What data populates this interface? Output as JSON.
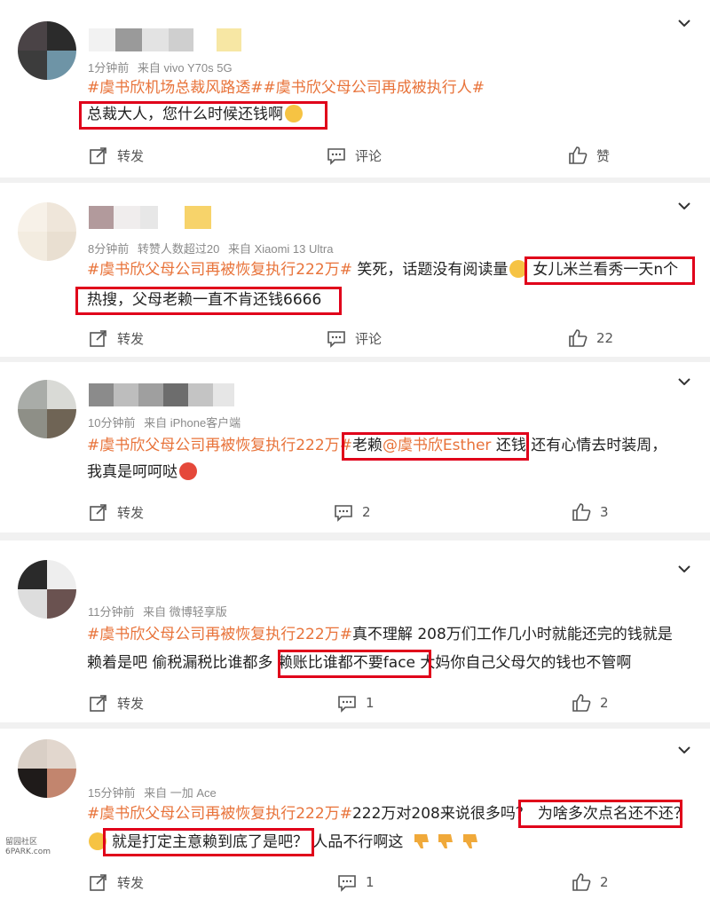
{
  "posts": [
    {
      "meta_time": "1分钟前",
      "meta_extra": "",
      "meta_source": "来自 vivo Y70s 5G",
      "line1_tag": "#虞书欣机场总裁风路透##虞书欣父母公司再成被执行人#",
      "line1_text": "",
      "line2_text": "总裁大人，您什么时候还钱啊",
      "repost_label": "转发",
      "comment_label": "评论",
      "like_label": "赞"
    },
    {
      "meta_time": "8分钟前",
      "meta_extra": "转赞人数超过20",
      "meta_source": "来自 Xiaomi 13 Ultra",
      "line1_tag": "#虞书欣父母公司再被恢复执行222万#",
      "line1_text": " 笑死，话题没有阅读量",
      "line1_text_b": "女儿米兰看秀一天n个",
      "line2_text": "热搜，父母老赖一直不肯还钱6666",
      "repost_label": "转发",
      "comment_label": "评论",
      "like_label": "22"
    },
    {
      "meta_time": "10分钟前",
      "meta_extra": "",
      "meta_source": "来自 iPhone客户端",
      "line1_tag": "#虞书欣父母公司再被恢复执行222万#",
      "line1_text_a": "老赖",
      "line1_mention": "@虞书欣Esther",
      "line1_text_b": " 还钱",
      "line1_text_c": "  还有心情去时装周，",
      "line2_text": "我真是呵呵哒",
      "repost_label": "转发",
      "comment_label": "2",
      "like_label": "3"
    },
    {
      "meta_time": "11分钟前",
      "meta_extra": "",
      "meta_source": "来自 微博轻享版",
      "line1_tag": "#虞书欣父母公司再被恢复执行222万#",
      "line1_text": "真不理解 208万们工作几小时就能还完的钱就是",
      "line2_text_a": "赖着是吧 偷税漏税比谁都多 ",
      "line2_text_b": "赖账比谁都不要face",
      "line2_text_c": " 大妈你自己父母欠的钱也不管啊",
      "repost_label": "转发",
      "comment_label": "1",
      "like_label": "2"
    },
    {
      "meta_time": "15分钟前",
      "meta_extra": "",
      "meta_source": "来自 一加 Ace",
      "line1_tag": "#虞书欣父母公司再被恢复执行222万#",
      "line1_text": "222万对208来说很多吗？",
      "line1_text_b": "为啥多次点名还不还？",
      "line2_text_a": "就是打定主意赖到底了是吧？",
      "line2_text_b": " 人品不行啊这",
      "repost_label": "转发",
      "comment_label": "1",
      "like_label": "2"
    }
  ],
  "watermark": {
    "line1": "留园社区",
    "line2": "6PARK.com"
  },
  "colors": {
    "tag": "#e8733a",
    "mention": "#e8733a",
    "highlight_box": "#e0001a",
    "meta": "#8a8a8a",
    "separator": "#f1f1f1"
  },
  "icons": [
    "chevron-down-icon",
    "repost-icon",
    "comment-icon",
    "like-icon",
    "emoji-icon",
    "thumbs-down-icon"
  ]
}
